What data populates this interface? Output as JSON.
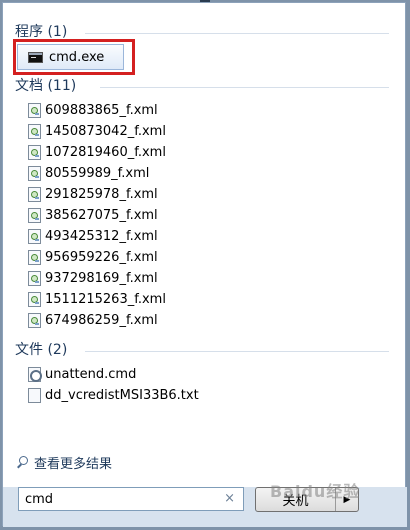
{
  "sections": {
    "programs": "程序 (1)",
    "documents": "文档 (11)",
    "files": "文件 (2)"
  },
  "program": {
    "label": "cmd.exe"
  },
  "documents": [
    "609883865_f.xml",
    "1450873042_f.xml",
    "1072819460_f.xml",
    "80559989_f.xml",
    "291825978_f.xml",
    "385627075_f.xml",
    "493425312_f.xml",
    "956959226_f.xml",
    "937298169_f.xml",
    "1511215263_f.xml",
    "674986259_f.xml"
  ],
  "files": [
    "unattend.cmd",
    "dd_vcredistMSI33B6.txt"
  ],
  "more_results": "查看更多结果",
  "search": {
    "value": "cmd",
    "clear": "×"
  },
  "shutdown": {
    "label": "关机",
    "arrow": "▶"
  },
  "watermark": "Baidu经验",
  "colors": {
    "highlight": "#d42020",
    "header": "#1e395b"
  }
}
